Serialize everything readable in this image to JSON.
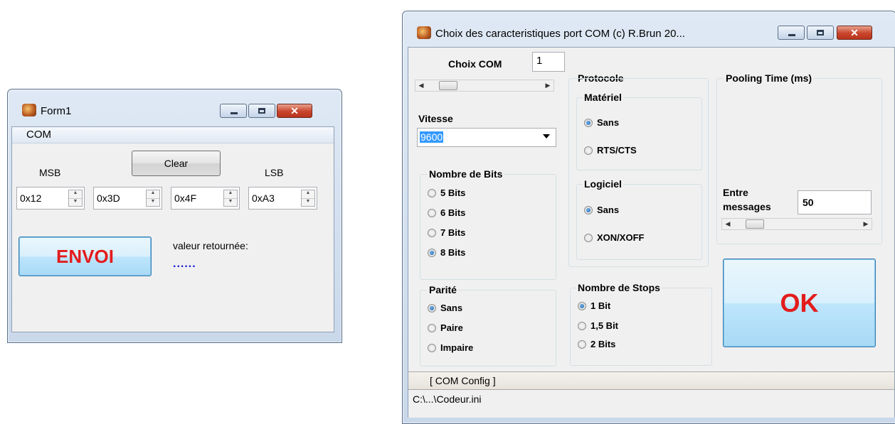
{
  "form1": {
    "title": "Form1",
    "menu": "COM",
    "clear_label": "Clear",
    "msb_label": "MSB",
    "lsb_label": "LSB",
    "bytes": [
      "0x12",
      "0x3D",
      "0x4F",
      "0xA3"
    ],
    "send_label": "ENVOI",
    "returned_label": "valeur retournée:",
    "returned_value": "......"
  },
  "com": {
    "title": "Choix des caracteristiques port COM (c) R.Brun 20...",
    "choix_com_label": "Choix COM",
    "choix_com_value": "1",
    "vitesse_label": "Vitesse",
    "vitesse_value": "9600",
    "bits_group": "Nombre de Bits",
    "bits_options": [
      "5 Bits",
      "6 Bits",
      "7 Bits",
      "8 Bits"
    ],
    "bits_selected": "8 Bits",
    "parite_group": "Parité",
    "parite_options": [
      "Sans",
      "Paire",
      "Impaire"
    ],
    "parite_selected": "Sans",
    "protocole_label": "Protocole",
    "materiel_group": "Matériel",
    "materiel_options": [
      "Sans",
      "RTS/CTS"
    ],
    "materiel_selected": "Sans",
    "logiciel_group": "Logiciel",
    "logiciel_options": [
      "Sans",
      "XON/XOFF"
    ],
    "logiciel_selected": "Sans",
    "stops_group": "Nombre de Stops",
    "stops_options": [
      "1 Bit",
      "1,5 Bit",
      "2 Bits"
    ],
    "stops_selected": "1 Bit",
    "pooling_group": "Pooling Time (ms)",
    "entre_label_1": "Entre",
    "entre_label_2": "messages",
    "entre_value": "50",
    "ok_label": "OK",
    "status_config": "[ COM Config ]",
    "status_path": "C:\\...\\Codeur.ini"
  },
  "colors": {
    "send_text": "#e31c1c",
    "ok_text": "#e31c1c",
    "returned_value": "#1515d6",
    "selected_field_bg": "#3399ff"
  },
  "icons": {
    "app": "app-icon",
    "minimize": "minimize-icon",
    "maximize": "maximize-icon",
    "close": "close-icon"
  }
}
